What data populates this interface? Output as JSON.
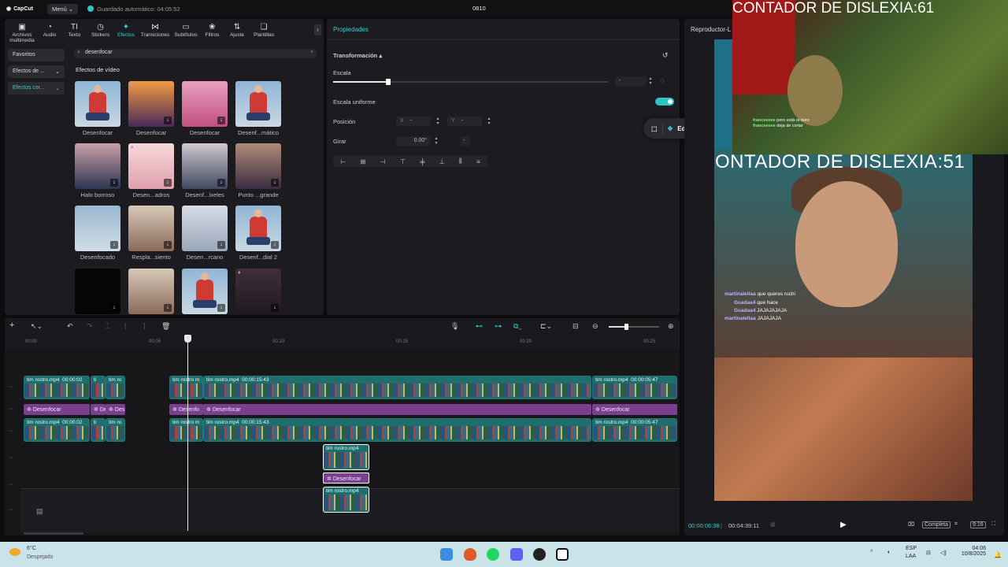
{
  "titlebar": {
    "app_name": "CapCut",
    "menu_label": "Menú",
    "autosave": "Guardado automático: 04:05:52",
    "project_name": "0810"
  },
  "toolbar": [
    {
      "label": "Archivos multimedia",
      "icon": "media-icon"
    },
    {
      "label": "Audio",
      "icon": "audio-icon"
    },
    {
      "label": "Texto",
      "icon": "text-icon"
    },
    {
      "label": "Stickers",
      "icon": "sticker-icon"
    },
    {
      "label": "Efectos",
      "icon": "effects-icon",
      "active": true
    },
    {
      "label": "Transiciones",
      "icon": "transition-icon"
    },
    {
      "label": "Subtítulos",
      "icon": "subtitle-icon"
    },
    {
      "label": "Filtros",
      "icon": "filter-icon"
    },
    {
      "label": "Ajuste",
      "icon": "adjust-icon"
    },
    {
      "label": "Plantillas",
      "icon": "template-icon"
    }
  ],
  "sidebar": {
    "items": [
      "Favoritos",
      "Efectos de ...",
      "Efectos cor..."
    ]
  },
  "search": {
    "value": "desenfocar"
  },
  "effects_section_title": "Efectos de vídeo",
  "effects": [
    {
      "label": "Desenfocar"
    },
    {
      "label": "Desenfocar"
    },
    {
      "label": "Desenfocar"
    },
    {
      "label": "Desenf...mático"
    },
    {
      "label": "Halo borroso"
    },
    {
      "label": "Desen...adros"
    },
    {
      "label": "Desenf...íxeles"
    },
    {
      "label": "Punto ...grande"
    },
    {
      "label": "Desenfocado"
    },
    {
      "label": "Respla...siento"
    },
    {
      "label": "Desen...rcano"
    },
    {
      "label": "Desenf...dial 2"
    },
    {
      "label": ""
    },
    {
      "label": ""
    },
    {
      "label": ""
    },
    {
      "label": ""
    }
  ],
  "properties": {
    "tab": "Propiedades",
    "section": "Transformación",
    "scale_label": "Escala",
    "scale_value": "-",
    "uniform_scale_label": "Escala uniforme",
    "position_label": "Posición",
    "pos_x_label": "X",
    "pos_x_value": "-",
    "pos_y_label": "Y",
    "pos_y_value": "-",
    "rotate_label": "Girar",
    "rotate_value": "0.00°",
    "rotate_extra": "-"
  },
  "editpilot": {
    "label": "EditPilot"
  },
  "player": {
    "title": "Reproductor-L",
    "current_time": "00:00:06:38",
    "total_time": "00:04:39:11",
    "ratio_label": "Completa",
    "aspect_label": "9:16"
  },
  "overlay": {
    "counter_top": "CONTADOR DE DISLEXIA:61",
    "counter_mid": "ONTADOR DE DISLEXIA:51",
    "webcam_chat": [
      {
        "user": "franceeeee",
        "text": "pero está re bien"
      },
      {
        "user": "franceeeee",
        "text": "deja de cortar"
      }
    ],
    "video_chat": [
      {
        "user": "martinalellaa",
        "text": "que queres ruchi"
      },
      {
        "user": "Guadaa4",
        "text": "que hace"
      },
      {
        "user": "Guadaa4",
        "text": "JAJAJAJAJA"
      },
      {
        "user": "martinalellaa",
        "text": "JAJAJAJA"
      }
    ]
  },
  "timeline": {
    "ruler": [
      "00:00",
      "00:05",
      "00:10",
      "00:15",
      "00:20",
      "00:25"
    ],
    "clip_main": "tim rostro.mp4",
    "clip_main_dur": "00:00:02",
    "clip_mid_dur": "00:00:15:43",
    "clip_end_dur": "00:00:05:47",
    "clip_short_a": "tim rostro m",
    "clip_short_b": "tim ro",
    "fx_label": "Desenfocar",
    "fx_short_a": "De",
    "fx_short_b": "Des",
    "fx_short_c": "Desenfo",
    "floating_clip": "tim rostro.mp4",
    "floating_fx": "Desenfocar"
  },
  "taskbar": {
    "weather_temp": "6°C",
    "weather_desc": "Despejado",
    "lang": "ESP",
    "lang2": "LAA",
    "time": "04:06",
    "date": "10/8/2025"
  },
  "colors": {
    "accent": "#2ed1d1",
    "fx_clip": "#7a3f8f",
    "video_clip": "#1e6e6e"
  }
}
